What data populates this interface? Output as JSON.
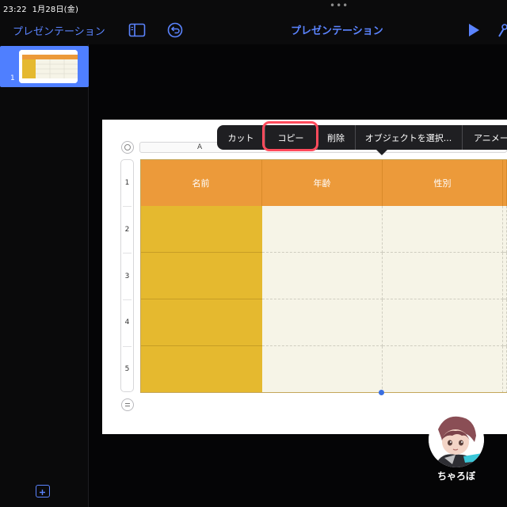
{
  "status": {
    "time": "23:22",
    "date": "1月28日(金)",
    "dots": "•••"
  },
  "toolbar": {
    "back_label": "プレゼンテーション",
    "title": "プレゼンテーション",
    "icons": [
      "sidebar-toggle-icon",
      "undo-icon",
      "play-icon",
      "wrench-icon"
    ]
  },
  "sidebar": {
    "slides": [
      {
        "number": "1"
      }
    ],
    "add_icon": "plus-icon"
  },
  "table": {
    "column_header": "A",
    "headers": [
      "名前",
      "年齢",
      "性別"
    ],
    "row_numbers": [
      "1",
      "2",
      "3",
      "4",
      "5"
    ]
  },
  "context_menu": {
    "items": [
      "カット",
      "コピー",
      "削除",
      "オブジェクトを選択...",
      "アニメー"
    ],
    "highlighted": "コピー"
  },
  "colors": {
    "accent": "#5b84ff",
    "header_orange": "#ec9a3a",
    "column_yellow": "#e5b92f",
    "cell_cream": "#f6f4e7",
    "highlight_red": "#ff4b5c"
  },
  "watermark": {
    "label": "ちゃろぼ"
  }
}
